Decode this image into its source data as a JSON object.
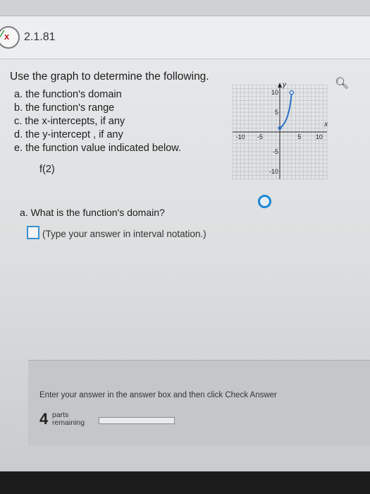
{
  "problem": {
    "id": "2.1.81"
  },
  "question": {
    "lead": "Use the graph to determine the following.",
    "items": [
      "a. the function's domain",
      "b. the function's range",
      "c. the x-intercepts, if any",
      "d. the y-intercept , if any",
      "e. the function value indicated below."
    ],
    "function_value": "f(2)"
  },
  "graph": {
    "x_label": "x",
    "y_label": "y",
    "ticks": {
      "x": [
        "-10",
        "-5",
        "5",
        "10"
      ],
      "y": [
        "10",
        "5",
        "-5",
        "-10"
      ]
    },
    "curve": {
      "closed_point": {
        "x": 0,
        "y": 1
      },
      "open_point": {
        "x": 3,
        "y": 10
      }
    }
  },
  "part_a": {
    "question": "a. What is the function's domain?",
    "hint": "(Type your answer in interval notation.)"
  },
  "footer": {
    "instruction": "Enter your answer in the answer box and then click Check Answer",
    "parts_count": "4",
    "parts_label_1": "parts",
    "parts_label_2": "remaining",
    "progress": 0.0
  },
  "colors": {
    "curve": "#2a6fc6",
    "accent": "#1b86d6"
  }
}
